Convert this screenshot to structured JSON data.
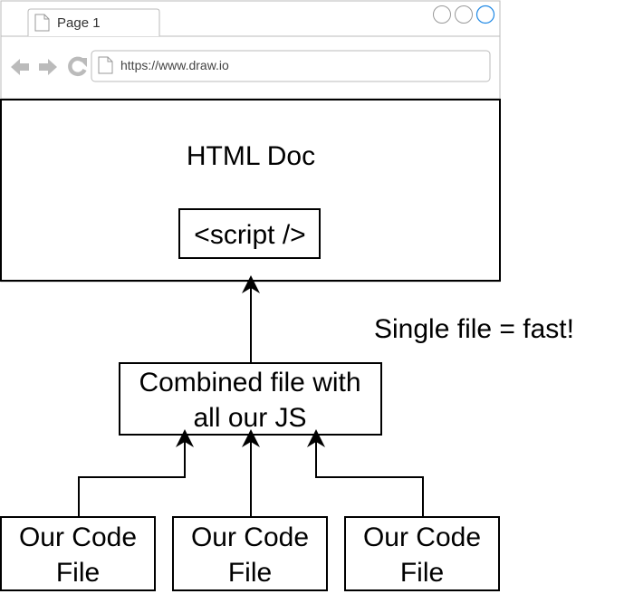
{
  "browser": {
    "tab_title": "Page 1",
    "url": "https://www.draw.io",
    "icons": {
      "back": "arrow-left-icon",
      "forward": "arrow-right-icon",
      "reload": "reload-icon",
      "page": "document-icon"
    },
    "window_controls": [
      "circle-icon",
      "circle-icon",
      "circle-icon"
    ],
    "accent": "#1e88e5",
    "chrome_gray": "#bbbbbb"
  },
  "diagram": {
    "html_doc_label": "HTML Doc",
    "script_tag_label": "<script />",
    "annotation": "Single file = fast!",
    "combined_box": {
      "line1": "Combined file with",
      "line2": "all our JS"
    },
    "code_files": [
      {
        "line1": "Our Code",
        "line2": "File"
      },
      {
        "line1": "Our Code",
        "line2": "File"
      },
      {
        "line1": "Our Code",
        "line2": "File"
      }
    ]
  }
}
